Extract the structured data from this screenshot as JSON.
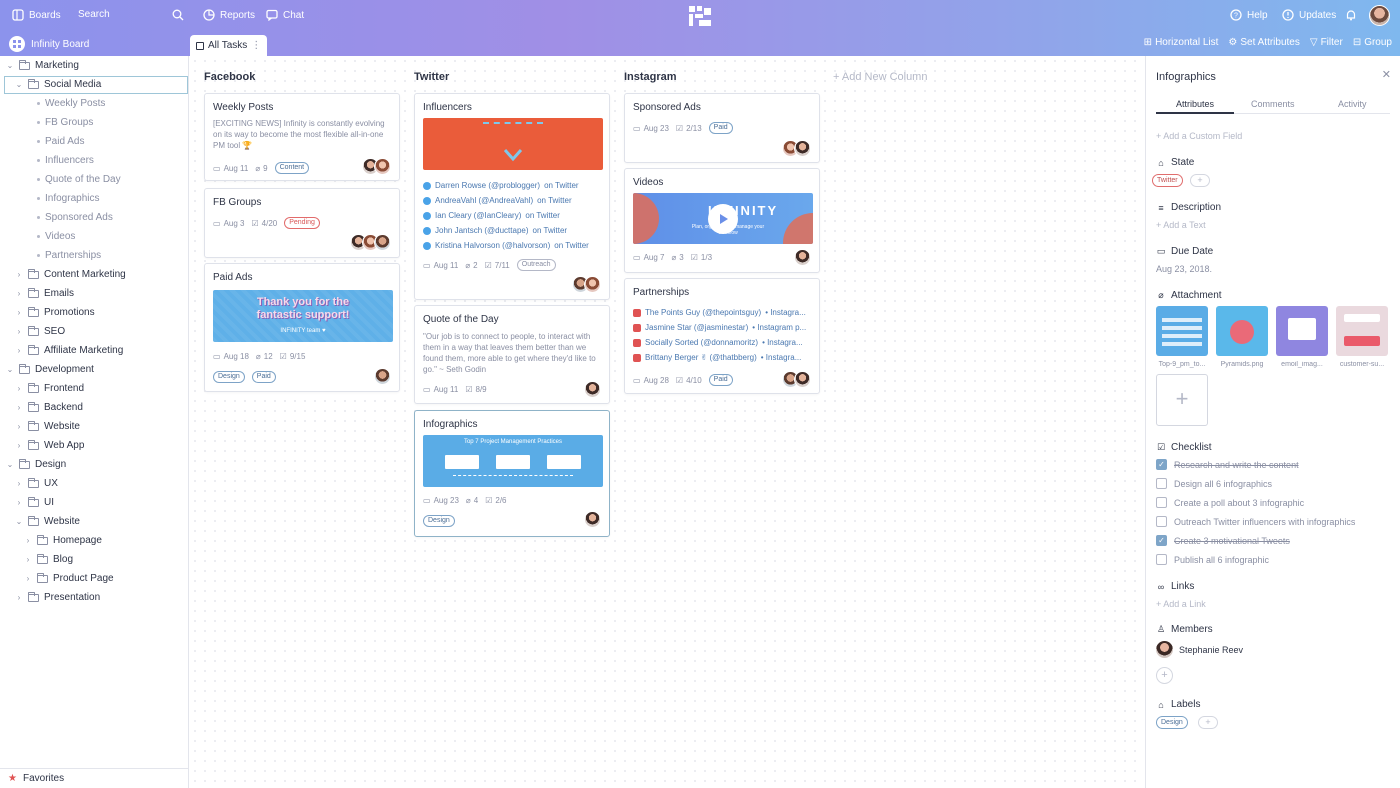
{
  "topbar": {
    "boards": "Boards",
    "search": "Search",
    "reports": "Reports",
    "chat": "Chat",
    "help": "Help",
    "updates": "Updates"
  },
  "tabbar": {
    "board_title": "Infinity Board",
    "active_tab": "All Tasks",
    "tools": [
      "Horizontal List",
      "Set Attributes",
      "Filter",
      "Group"
    ]
  },
  "sidebar": {
    "items": [
      {
        "label": "Marketing",
        "kind": "folder",
        "open": true
      },
      {
        "label": "Social Media",
        "kind": "folder",
        "open": true
      },
      {
        "label": "Weekly Posts",
        "kind": "item"
      },
      {
        "label": "FB Groups",
        "kind": "item"
      },
      {
        "label": "Paid Ads",
        "kind": "item"
      },
      {
        "label": "Influencers",
        "kind": "item"
      },
      {
        "label": "Quote of the Day",
        "kind": "item"
      },
      {
        "label": "Infographics",
        "kind": "item"
      },
      {
        "label": "Sponsored Ads",
        "kind": "item"
      },
      {
        "label": "Videos",
        "kind": "item"
      },
      {
        "label": "Partnerships",
        "kind": "item"
      },
      {
        "label": "Content Marketing",
        "kind": "folder"
      },
      {
        "label": "Emails",
        "kind": "folder"
      },
      {
        "label": "Promotions",
        "kind": "folder"
      },
      {
        "label": "SEO",
        "kind": "folder"
      },
      {
        "label": "Affiliate Marketing",
        "kind": "folder"
      },
      {
        "label": "Development",
        "kind": "folder",
        "open": true
      },
      {
        "label": "Frontend",
        "kind": "folder"
      },
      {
        "label": "Backend",
        "kind": "folder"
      },
      {
        "label": "Website",
        "kind": "folder"
      },
      {
        "label": "Web App",
        "kind": "folder"
      },
      {
        "label": "Design",
        "kind": "folder",
        "open": true
      },
      {
        "label": "UX",
        "kind": "folder"
      },
      {
        "label": "UI",
        "kind": "folder"
      },
      {
        "label": "Website",
        "kind": "folder",
        "open": true
      },
      {
        "label": "Homepage",
        "kind": "folder"
      },
      {
        "label": "Blog",
        "kind": "folder"
      },
      {
        "label": "Product Page",
        "kind": "folder"
      },
      {
        "label": "Presentation",
        "kind": "folder"
      }
    ],
    "favorites": "Favorites"
  },
  "board": {
    "columns": [
      "Facebook",
      "Twitter",
      "Instagram"
    ],
    "add_column": "+ Add New Column",
    "cards": {
      "weekly_posts": {
        "title": "Weekly Posts",
        "desc": "[EXCITING NEWS] Infinity is constantly evolving on its way to become the most flexible all-in-one PM tool 🏆",
        "date": "Aug 11",
        "attach": "9",
        "label": "Content"
      },
      "fb_groups": {
        "title": "FB Groups",
        "date": "Aug 3",
        "check": "4/20",
        "label": "Pending"
      },
      "paid_ads": {
        "title": "Paid Ads",
        "img_text": "Thank you for the fantastic support!",
        "img_sub": "INFINITY team ♥",
        "date": "Aug 18",
        "attach": "12",
        "check": "9/15",
        "labels": [
          "Design",
          "Paid"
        ]
      },
      "influencers": {
        "title": "Influencers",
        "links": [
          {
            "name": "Darren Rowse (@problogger)",
            "suffix": "on Twitter"
          },
          {
            "name": "AndreaVahl (@AndreaVahl)",
            "suffix": "on Twitter"
          },
          {
            "name": "Ian Cleary (@IanCleary)",
            "suffix": "on Twitter"
          },
          {
            "name": "John Jantsch (@ducttape)",
            "suffix": "on Twitter"
          },
          {
            "name": "Kristina Halvorson (@halvorson)",
            "suffix": "on Twitter"
          }
        ],
        "date": "Aug 11",
        "attach": "2",
        "check": "7/11",
        "label": "Outreach"
      },
      "quote": {
        "title": "Quote of the Day",
        "desc": "\"Our job is to connect to people, to interact with them in a way that leaves them better than we found them, more able to get where they'd like to go.\" ~ Seth Godin",
        "date": "Aug 11",
        "check": "8/9"
      },
      "infographics": {
        "title": "Infographics",
        "img_title": "Top 7 Project Management Practices",
        "date": "Aug 23",
        "attach": "4",
        "check": "2/6",
        "label": "Design"
      },
      "sponsored": {
        "title": "Sponsored Ads",
        "date": "Aug 23",
        "check": "2/13",
        "label": "Paid"
      },
      "videos": {
        "title": "Videos",
        "img_brand": "INFINITY",
        "img_sub": "Plan, organize and manage your workflow",
        "date": "Aug 7",
        "attach": "3",
        "check": "1/3"
      },
      "partnerships": {
        "title": "Partnerships",
        "links": [
          {
            "name": "The Points Guy (@thepointsguy)",
            "suffix": "• Instagra..."
          },
          {
            "name": "Jasmine Star (@jasminestar)",
            "suffix": "• Instagram p..."
          },
          {
            "name": "Socially Sorted (@donnamoritz)",
            "suffix": "• Instagra..."
          },
          {
            "name": "Brittany Berger ✌ (@thatbberg)",
            "suffix": "• Instagra..."
          }
        ],
        "date": "Aug 28",
        "check": "4/10",
        "label": "Paid"
      }
    }
  },
  "panel": {
    "title": "Infographics",
    "tabs": [
      "Attributes",
      "Comments",
      "Activity"
    ],
    "add_custom_field": "+ Add a Custom Field",
    "state_label": "State",
    "state_value": "Twitter",
    "description_label": "Description",
    "add_text": "+ Add a Text",
    "due_label": "Due Date",
    "due_value": "Aug 23, 2018.",
    "attachment_label": "Attachment",
    "attachments": [
      "Top-9_pm_to...",
      "Pyramids.png",
      "emoil_imag...",
      "customer-su..."
    ],
    "checklist_label": "Checklist",
    "checklist": [
      {
        "text": "Research and write the content",
        "done": true
      },
      {
        "text": "Design all 6 infographics",
        "done": false
      },
      {
        "text": "Create a poll about 3 infographic",
        "done": false
      },
      {
        "text": "Outreach Twitter influencers with infographics",
        "done": false
      },
      {
        "text": "Create 3 motivational Tweets",
        "done": true
      },
      {
        "text": "Publish all 6 infographic",
        "done": false
      }
    ],
    "links_label": "Links",
    "add_link": "+ Add a Link",
    "members_label": "Members",
    "member_name": "Stephanie Reev",
    "labels_label": "Labels",
    "label_value": "Design"
  },
  "colors": {
    "accent": "#8c93ec",
    "badge_blue": "#4b6e96",
    "badge_red": "#d85757"
  }
}
